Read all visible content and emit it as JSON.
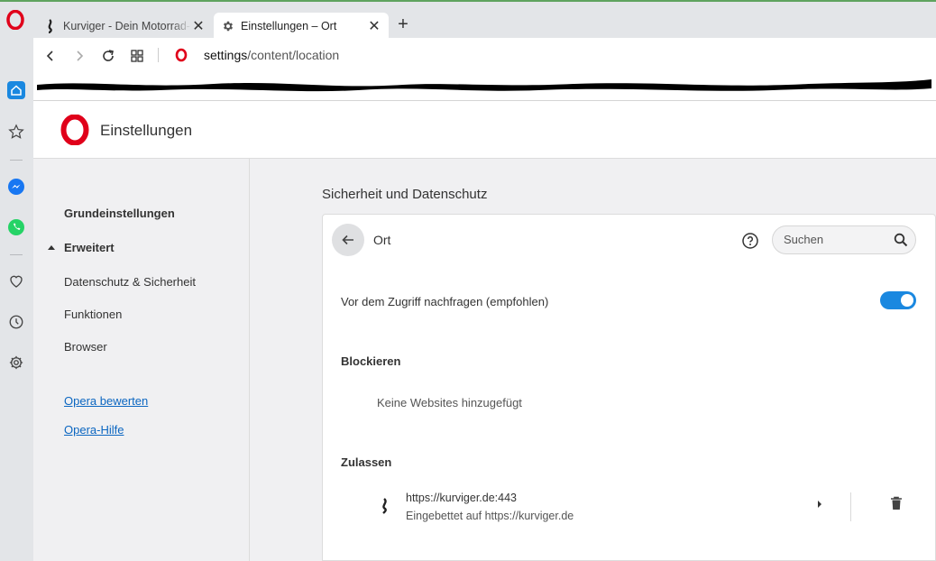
{
  "tabs": [
    {
      "title": "Kurviger - Dein Motorrad-Routenplaner",
      "icon": "kurviger-favicon",
      "active": false
    },
    {
      "title": "Einstellungen – Ort",
      "icon": "gear-icon",
      "active": true
    }
  ],
  "address": {
    "host": "settings",
    "path": "/content/location"
  },
  "header": {
    "title": "Einstellungen"
  },
  "nav": {
    "basic": "Grundeinstellungen",
    "advanced": "Erweitert",
    "privacy": "Datenschutz & Sicherheit",
    "features": "Funktionen",
    "browser": "Browser",
    "rate": "Opera bewerten",
    "help": "Opera-Hilfe"
  },
  "main": {
    "section_title": "Sicherheit und Datenschutz",
    "page_heading": "Ort",
    "search_placeholder": "Suchen",
    "ask_label": "Vor dem Zugriff nachfragen (empfohlen)",
    "ask_enabled": true,
    "block_title": "Blockieren",
    "block_empty": "Keine Websites hinzugefügt",
    "allow_title": "Zulassen",
    "allowed_sites": [
      {
        "url": "https://kurviger.de:443",
        "embedded": "Eingebettet auf https://kurviger.de"
      }
    ]
  },
  "colors": {
    "accent": "#1a88e0",
    "opera_red": "#e0001a",
    "link": "#0b66c1"
  }
}
